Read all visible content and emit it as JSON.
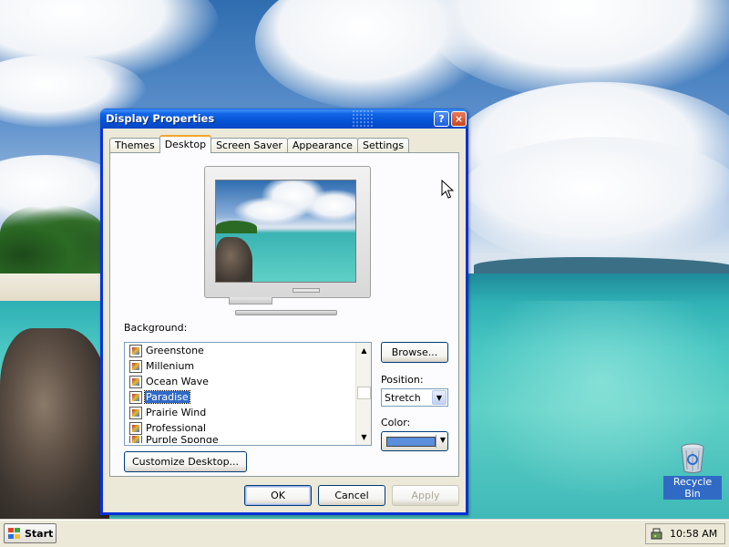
{
  "window": {
    "title": "Display Properties",
    "help_symbol": "?",
    "close_symbol": "×"
  },
  "tabs": [
    {
      "label": "Themes",
      "active": false
    },
    {
      "label": "Desktop",
      "active": true
    },
    {
      "label": "Screen Saver",
      "active": false
    },
    {
      "label": "Appearance",
      "active": false
    },
    {
      "label": "Settings",
      "active": false
    }
  ],
  "desktop_tab": {
    "background_label": "Background:",
    "backgrounds": [
      {
        "name": "Greenstone",
        "selected": false
      },
      {
        "name": "Millenium",
        "selected": false
      },
      {
        "name": "Ocean Wave",
        "selected": false
      },
      {
        "name": "Paradise",
        "selected": true
      },
      {
        "name": "Prairie Wind",
        "selected": false
      },
      {
        "name": "Professional",
        "selected": false
      },
      {
        "name": "Purple Sponge",
        "selected": false
      }
    ],
    "browse_label": "Browse...",
    "position_label": "Position:",
    "position_value": "Stretch",
    "color_label": "Color:",
    "color_value": "#5b8fde",
    "customize_label": "Customize Desktop..."
  },
  "dialog_buttons": {
    "ok": "OK",
    "cancel": "Cancel",
    "apply": "Apply"
  },
  "desktop_icons": {
    "recycle_bin": "Recycle Bin"
  },
  "taskbar": {
    "start_label": "Start",
    "clock": "10:58 AM"
  },
  "colors": {
    "title_bar": "#0553d6",
    "selection": "#316ac5",
    "active_tab_accent": "#f3a429",
    "window_face": "#ece9d8"
  }
}
